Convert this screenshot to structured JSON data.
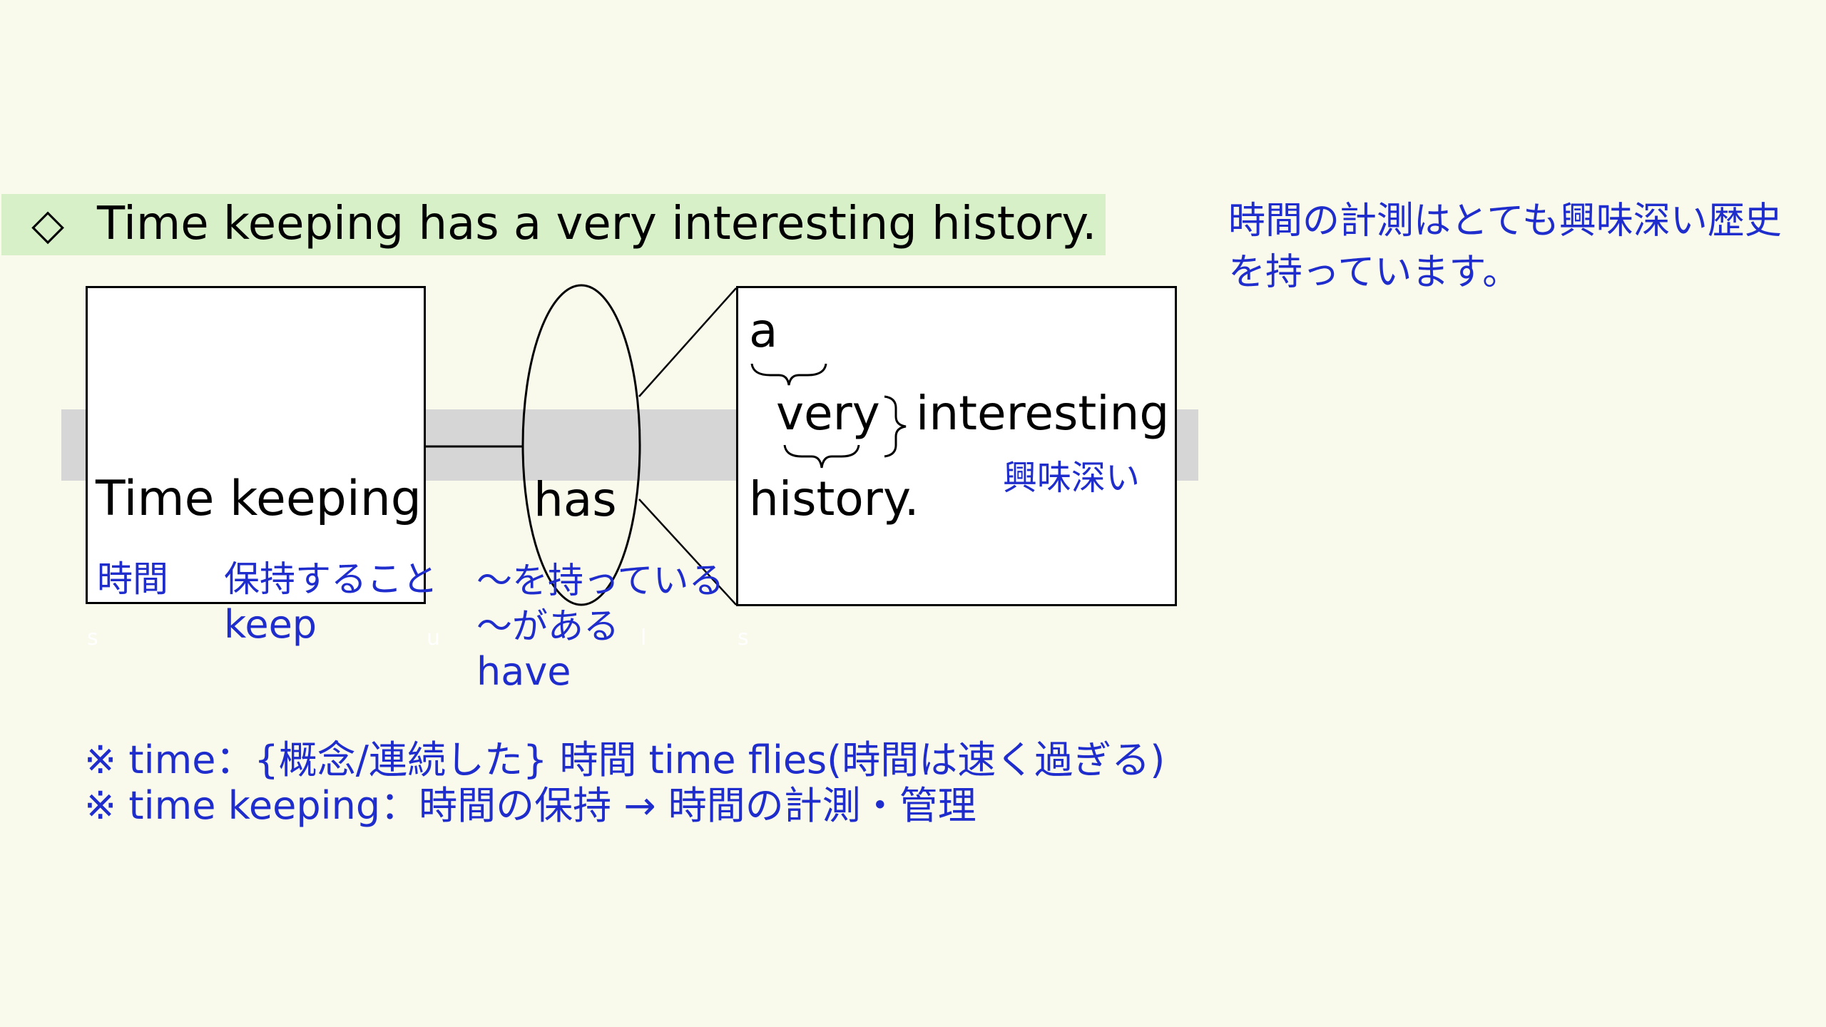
{
  "title": {
    "marker": "◇",
    "sentence": "Time keeping has a very  interesting history."
  },
  "translation": "時間の計測はとても興味深い歴史を持っています。",
  "subject": {
    "text": "Time keeping",
    "gloss_time": "時間",
    "gloss_keeping": "保持すること",
    "gloss_keep": "keep"
  },
  "verb": {
    "text": "has",
    "gloss_1": "〜を持っている",
    "gloss_2": "〜がある",
    "gloss_3": "have"
  },
  "object": {
    "article": "a",
    "adverb": "very",
    "adjective": "interesting",
    "noun": "history.",
    "gloss": "興味深い"
  },
  "faint_labels": {
    "s1": "s",
    "u": "u",
    "l": "l",
    "s2": "s"
  },
  "notes": [
    "※ time：{概念/連続した} 時間 time flies(時間は速く過ぎる)",
    "※ time keeping：時間の保持 → 時間の計測・管理"
  ],
  "colors": {
    "background": "#f9f9ec",
    "title_bar": "#d7f0c8",
    "gloss_blue": "#1f2dcc",
    "band_gray": "#d6d6d6"
  }
}
